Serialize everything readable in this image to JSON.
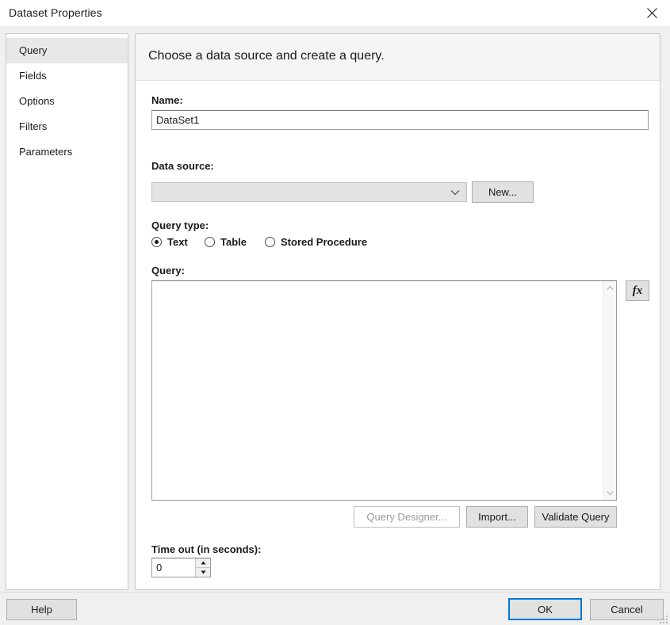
{
  "window": {
    "title": "Dataset Properties",
    "close_icon": "close-icon"
  },
  "sidebar": {
    "items": [
      {
        "label": "Query",
        "selected": true
      },
      {
        "label": "Fields",
        "selected": false
      },
      {
        "label": "Options",
        "selected": false
      },
      {
        "label": "Filters",
        "selected": false
      },
      {
        "label": "Parameters",
        "selected": false
      }
    ]
  },
  "content": {
    "header": "Choose a data source and create a query.",
    "name": {
      "label": "Name:",
      "value": "DataSet1",
      "placeholder": ""
    },
    "datasource": {
      "label": "Data source:",
      "value": "",
      "arrow_icon": "chevron-down-icon",
      "new_button": "New..."
    },
    "query_type": {
      "label": "Query type:",
      "options": [
        {
          "label": "Text",
          "checked": true
        },
        {
          "label": "Table",
          "checked": false
        },
        {
          "label": "Stored Procedure",
          "checked": false
        }
      ]
    },
    "query": {
      "label": "Query:",
      "value": "",
      "expression_button": "fx",
      "scroll_up_icon": "chevron-up-icon",
      "scroll_down_icon": "chevron-down-icon"
    },
    "actions": {
      "query_designer": "Query Designer...",
      "query_designer_disabled": true,
      "import": "Import...",
      "validate_query": "Validate Query"
    },
    "timeout": {
      "label": "Time out (in seconds):",
      "value": "0",
      "increment_icon": "triangle-up-icon",
      "decrement_icon": "triangle-down-icon"
    }
  },
  "footer": {
    "help": "Help",
    "ok": "OK",
    "cancel": "Cancel",
    "resize_grip_icon": "resize-grip-icon"
  },
  "colors": {
    "accent": "#0078d7",
    "dialog_bg": "#f0f0f0",
    "panel_bg": "#ffffff",
    "header_bg": "#f5f5f5",
    "selected_nav_bg": "#e8e8e8",
    "button_bg": "#e1e1e1",
    "disabled_text": "#9a9a9a"
  }
}
